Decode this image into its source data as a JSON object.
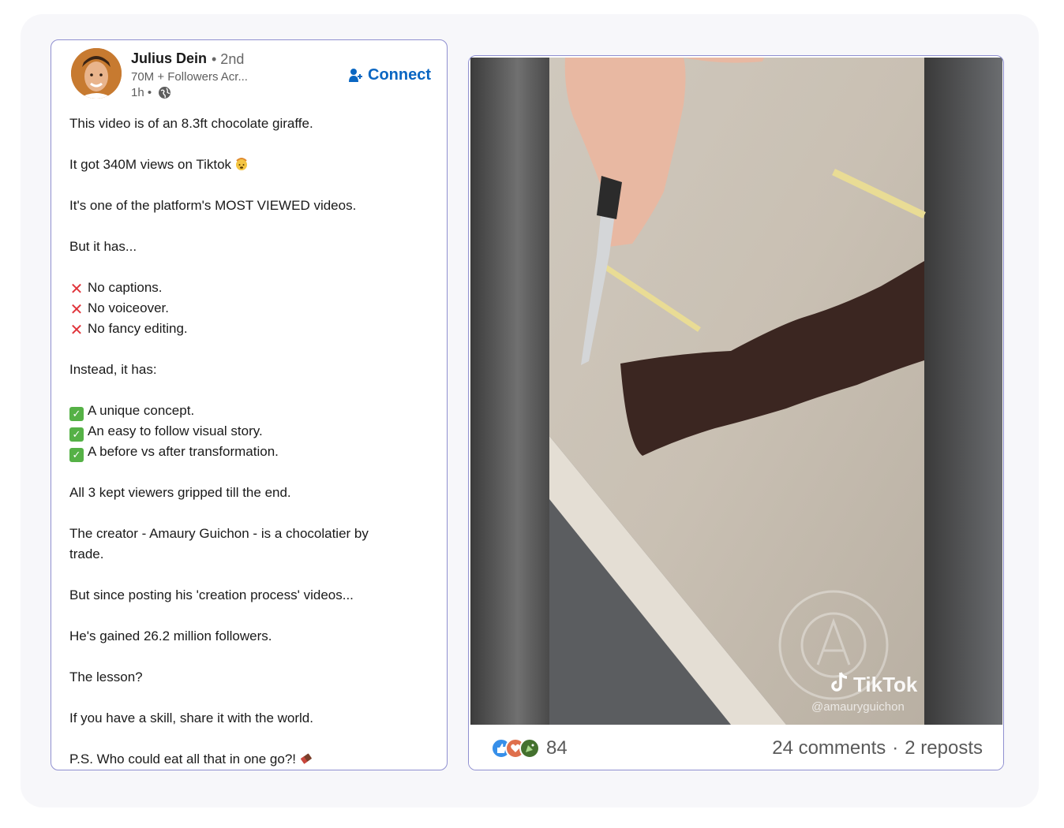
{
  "post": {
    "author": {
      "name": "Julius Dein",
      "degree": "• 2nd",
      "followers": "70M + Followers Acr...",
      "time": "1h •"
    },
    "connect_label": "Connect",
    "lines": [
      "This video is of an 8.3ft chocolate giraffe.",
      "",
      "It got 340M views on Tiktok",
      "",
      "It's one of the platform's MOST VIEWED videos.",
      "",
      "But it has...",
      "",
      "No captions.",
      "No voiceover.",
      "No fancy editing.",
      "",
      "Instead, it has:",
      "",
      "A unique concept.",
      "An easy to follow visual story.",
      "A before vs after transformation.",
      "",
      "All 3 kept viewers gripped till the end.",
      "",
      "The creator - Amaury Guichon - is a chocolatier by",
      "trade.",
      "",
      "But since posting his 'creation process' videos...",
      "",
      "He's gained 26.2 million followers.",
      "",
      "The lesson?",
      "",
      "If you have a skill, share it with the world.",
      "",
      "P.S. Who could eat all that in one go?!"
    ]
  },
  "video": {
    "watermark_brand": "TikTok",
    "watermark_handle": "@amauryguichon"
  },
  "social": {
    "reaction_count": "84",
    "comments": "24 comments",
    "separator": "·",
    "reposts": "2 reposts"
  },
  "colors": {
    "link_blue": "#0a66c2",
    "card_border": "#8f8fd0",
    "x_red": "#e0343b",
    "check_green": "#55b146"
  },
  "icons": {
    "line_markers": [
      "",
      "",
      "",
      "",
      "",
      "",
      "",
      "",
      "x",
      "x",
      "x",
      "",
      "",
      "",
      "check",
      "check",
      "check"
    ]
  }
}
